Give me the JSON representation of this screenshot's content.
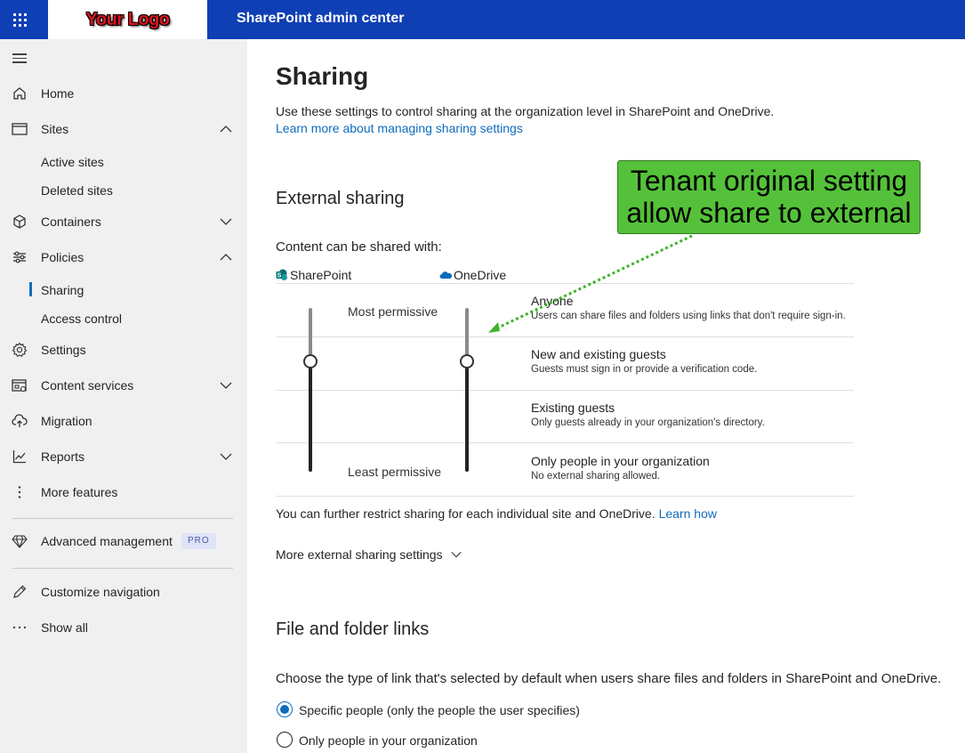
{
  "header": {
    "logo_text": "Your Logo",
    "app_title": "SharePoint admin center"
  },
  "sidebar": {
    "items": [
      {
        "label": "Home",
        "icon": "home-icon"
      },
      {
        "label": "Sites",
        "icon": "sites-icon",
        "expanded": true,
        "children": [
          "Active sites",
          "Deleted sites"
        ]
      },
      {
        "label": "Containers",
        "icon": "containers-icon",
        "expanded": false
      },
      {
        "label": "Policies",
        "icon": "policies-icon",
        "expanded": true,
        "children": [
          "Sharing",
          "Access control"
        ],
        "active_child": "Sharing"
      },
      {
        "label": "Settings",
        "icon": "gear-icon"
      },
      {
        "label": "Content services",
        "icon": "content-services-icon",
        "expanded": false
      },
      {
        "label": "Migration",
        "icon": "cloud-upload-icon"
      },
      {
        "label": "Reports",
        "icon": "chart-icon",
        "expanded": false
      },
      {
        "label": "More features",
        "icon": "more-vertical-icon"
      }
    ],
    "advanced": {
      "label": "Advanced management",
      "badge": "PRO",
      "icon": "diamond-icon"
    },
    "customize": {
      "label": "Customize navigation",
      "icon": "pencil-icon"
    },
    "show_all": {
      "label": "Show all",
      "icon": "ellipsis-icon"
    }
  },
  "main": {
    "title": "Sharing",
    "description": "Use these settings to control sharing at the organization level in SharePoint and OneDrive.",
    "learn_more": "Learn more about managing sharing settings",
    "external_sharing": {
      "heading": "External sharing",
      "content_label": "Content can be shared with:",
      "sharepoint_label": "SharePoint",
      "onedrive_label": "OneDrive",
      "most_permissive": "Most permissive",
      "least_permissive": "Least permissive",
      "sharepoint_level": "New and existing guests",
      "onedrive_level": "New and existing guests",
      "levels": [
        {
          "title": "Anyone",
          "desc": "Users can share files and folders using links that don't require sign-in."
        },
        {
          "title": "New and existing guests",
          "desc": "Guests must sign in or provide a verification code."
        },
        {
          "title": "Existing guests",
          "desc": "Only guests already in your organization's directory."
        },
        {
          "title": "Only people in your organization",
          "desc": "No external sharing allowed."
        }
      ],
      "restrict_text": "You can further restrict sharing for each individual site and OneDrive.",
      "learn_how": "Learn how",
      "more_settings": "More external sharing settings"
    },
    "file_folder_links": {
      "heading": "File and folder links",
      "prompt": "Choose the type of link that's selected by default when users share files and folders in SharePoint and OneDrive.",
      "options": [
        {
          "label": "Specific people (only the people the user specifies)",
          "checked": true
        },
        {
          "label": "Only people in your organization",
          "checked": false
        }
      ]
    }
  },
  "annotation": {
    "line1": "Tenant original setting",
    "line2": "allow share to external",
    "color": "#55c13a"
  }
}
